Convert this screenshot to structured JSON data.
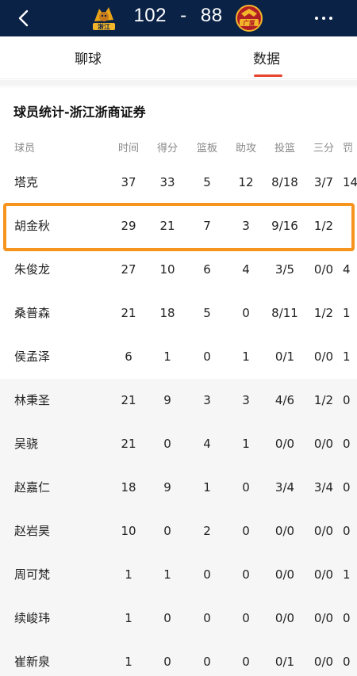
{
  "header": {
    "home_team": "浙江",
    "away_team": "广厦",
    "home_score": "102",
    "separator": "-",
    "away_score": "88"
  },
  "tabs": [
    {
      "label": "聊球",
      "active": false
    },
    {
      "label": "数据",
      "active": true
    }
  ],
  "colors": {
    "topbar": "#0b2247",
    "accent": "#e8422f",
    "highlight": "#f7941d"
  },
  "section_title": "球员统计-浙江浙商证券",
  "columns": [
    "球员",
    "时间",
    "得分",
    "篮板",
    "助攻",
    "投篮",
    "三分",
    "罚"
  ],
  "players": [
    {
      "name": "塔克",
      "time": "37",
      "points": "33",
      "rebounds": "5",
      "assists": "12",
      "fg": "8/18",
      "three": "3/7",
      "ft": "14"
    },
    {
      "name": "胡金秋",
      "time": "29",
      "points": "21",
      "rebounds": "7",
      "assists": "3",
      "fg": "9/16",
      "three": "1/2",
      "ft": ""
    },
    {
      "name": "朱俊龙",
      "time": "27",
      "points": "10",
      "rebounds": "6",
      "assists": "4",
      "fg": "3/5",
      "three": "0/0",
      "ft": "4"
    },
    {
      "name": "桑普森",
      "time": "21",
      "points": "18",
      "rebounds": "5",
      "assists": "0",
      "fg": "8/11",
      "three": "1/2",
      "ft": "1"
    },
    {
      "name": "侯孟泽",
      "time": "6",
      "points": "1",
      "rebounds": "0",
      "assists": "1",
      "fg": "0/1",
      "three": "0/0",
      "ft": "1"
    },
    {
      "name": "林秉圣",
      "time": "21",
      "points": "9",
      "rebounds": "3",
      "assists": "3",
      "fg": "4/6",
      "three": "1/2",
      "ft": "0"
    },
    {
      "name": "吴骁",
      "time": "21",
      "points": "0",
      "rebounds": "4",
      "assists": "1",
      "fg": "0/0",
      "three": "0/0",
      "ft": "0"
    },
    {
      "name": "赵嘉仁",
      "time": "18",
      "points": "9",
      "rebounds": "1",
      "assists": "0",
      "fg": "3/4",
      "three": "3/4",
      "ft": "0"
    },
    {
      "name": "赵岩昊",
      "time": "10",
      "points": "0",
      "rebounds": "2",
      "assists": "0",
      "fg": "0/0",
      "three": "0/0",
      "ft": "0"
    },
    {
      "name": "周可梵",
      "time": "1",
      "points": "1",
      "rebounds": "0",
      "assists": "0",
      "fg": "0/0",
      "three": "0/0",
      "ft": "1"
    },
    {
      "name": "续峻玮",
      "time": "1",
      "points": "0",
      "rebounds": "0",
      "assists": "0",
      "fg": "0/0",
      "three": "0/0",
      "ft": "0"
    },
    {
      "name": "崔新泉",
      "time": "1",
      "points": "0",
      "rebounds": "0",
      "assists": "0",
      "fg": "0/1",
      "three": "0/0",
      "ft": "0"
    }
  ]
}
